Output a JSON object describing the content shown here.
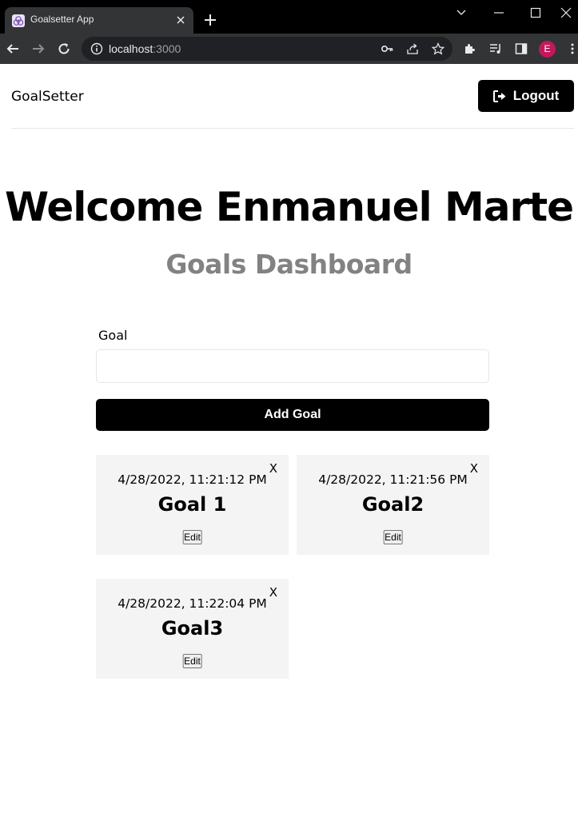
{
  "browser": {
    "tab_title": "Goalsetter App",
    "url_host": "localhost",
    "url_port": ":3000",
    "profile_initial": "E"
  },
  "header": {
    "brand": "GoalSetter",
    "logout_label": "Logout"
  },
  "welcome": {
    "title": "Welcome Enmanuel Marte",
    "subtitle": "Goals Dashboard"
  },
  "form": {
    "goal_label": "Goal",
    "goal_value": "",
    "add_button": "Add Goal"
  },
  "goals": [
    {
      "date": "4/28/2022, 11:21:12 PM",
      "title": "Goal 1",
      "close": "X",
      "edit": "Edit"
    },
    {
      "date": "4/28/2022, 11:21:56 PM",
      "title": "Goal2",
      "close": "X",
      "edit": "Edit"
    },
    {
      "date": "4/28/2022, 11:22:04 PM",
      "title": "Goal3",
      "close": "X",
      "edit": "Edit"
    }
  ],
  "colors": {
    "primary": "#000000",
    "subtitle": "#828282",
    "card_bg": "#f4f4f4",
    "avatar": "#c2185b"
  }
}
